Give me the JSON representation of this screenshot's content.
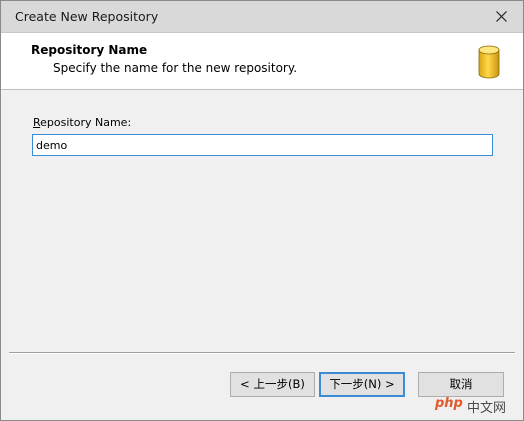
{
  "window": {
    "title": "Create New Repository"
  },
  "header": {
    "title": "Repository Name",
    "subtitle": "Specify the name for the new repository.",
    "icon": "database-icon"
  },
  "form": {
    "label_prefix": "R",
    "label_rest": "epository Name:",
    "name_value": "demo"
  },
  "buttons": {
    "back": "< 上一步(B)",
    "next": "下一步(N) >",
    "cancel": "取消"
  },
  "watermark": {
    "text1": "php",
    "text2": "中文网"
  },
  "colors": {
    "focus_border": "#3c8bd5",
    "titlebar": "#d9d9d9",
    "dialog_bg": "#f0f0f0",
    "db_icon": "#f2c12e"
  }
}
